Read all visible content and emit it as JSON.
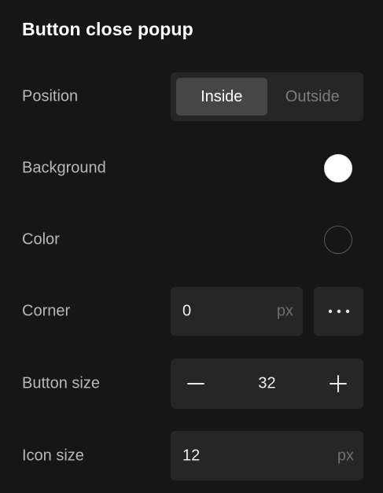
{
  "panel": {
    "title": "Button close popup"
  },
  "position": {
    "label": "Position",
    "options": [
      "Inside",
      "Outside"
    ],
    "selected": "Inside"
  },
  "background": {
    "label": "Background",
    "color": "#ffffff"
  },
  "color": {
    "label": "Color",
    "color": "#161616"
  },
  "corner": {
    "label": "Corner",
    "value": "0",
    "unit": "px",
    "more_icon": "more-horizontal-icon"
  },
  "button_size": {
    "label": "Button size",
    "value": "32",
    "decrement_icon": "minus-icon",
    "increment_icon": "plus-icon"
  },
  "icon_size": {
    "label": "Icon size",
    "value": "12",
    "unit": "px"
  },
  "colors": {
    "panel_bg": "#161616",
    "control_bg": "#262626",
    "active_segment": "#464646"
  }
}
